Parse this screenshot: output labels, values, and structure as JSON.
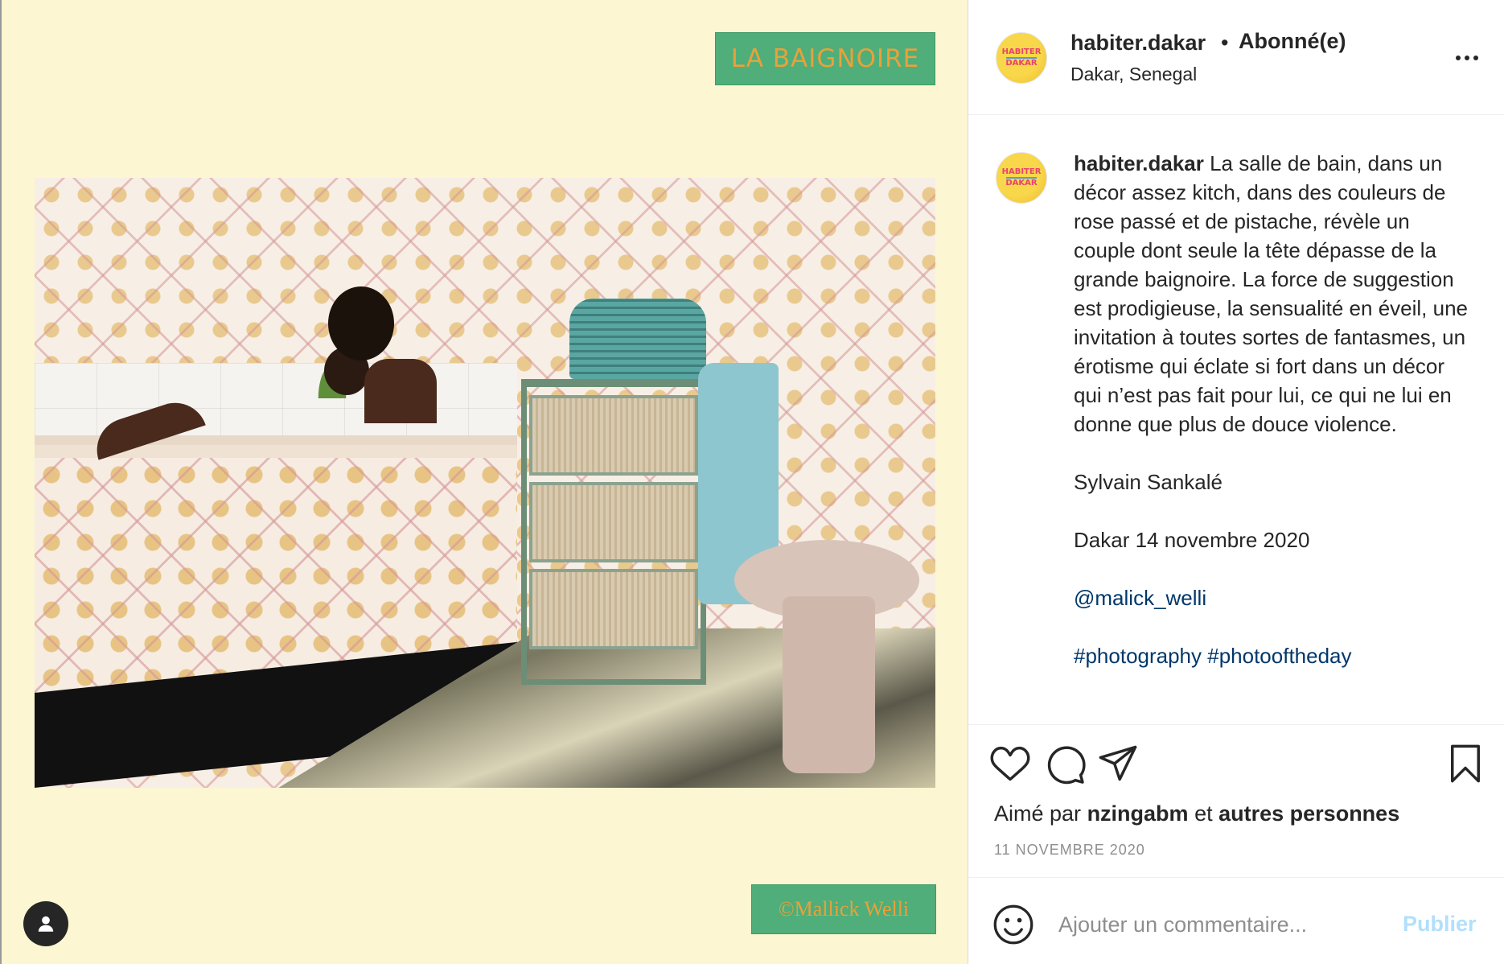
{
  "media": {
    "title_badge": "LA BAIGNOIRE",
    "credit_badge": "©Mallick Welli",
    "badge_bg": "#4fae7a",
    "badge_text_color": "#e9a13a",
    "background": "#fdf6d2",
    "photo_icon": "bathroom-photo"
  },
  "header": {
    "avatar_line1": "HABITER",
    "avatar_line2": "DAKAR",
    "username": "habiter.dakar",
    "separator": "•",
    "follow_status": "Abonné(e)",
    "location": "Dakar, Senegal",
    "more_icon": "more-horizontal-icon"
  },
  "caption": {
    "username": "habiter.dakar",
    "text": "La salle de bain, dans un décor assez kitch, dans des couleurs de rose passé et de pistache, révèle un couple dont seule la tête dépasse de la grande baignoire. La force de suggestion est prodigieuse, la sensualité en éveil, une invitation à toutes sortes de fantasmes, un érotisme qui éclate si fort dans un décor qui n’est pas fait pour lui, ce qui ne lui en donne que plus de douce violence.",
    "author": "Sylvain Sankalé",
    "dateline": "Dakar 14 novembre 2020",
    "mention": "@malick_welli",
    "hashtags": "#photography #photooftheday"
  },
  "actions": {
    "like_icon": "heart-icon",
    "comment_icon": "comment-bubble-icon",
    "share_icon": "paper-plane-icon",
    "save_icon": "bookmark-icon",
    "likes_prefix": "Aimé par",
    "likes_user": "nzingabm",
    "likes_join": "et",
    "likes_others": "autres personnes",
    "post_date": "11 NOVEMBRE 2020"
  },
  "comment": {
    "emoji_icon": "emoji-smile-icon",
    "placeholder": "Ajouter un commentaire...",
    "publish_label": "Publier",
    "publish_color": "#b2dffc"
  }
}
